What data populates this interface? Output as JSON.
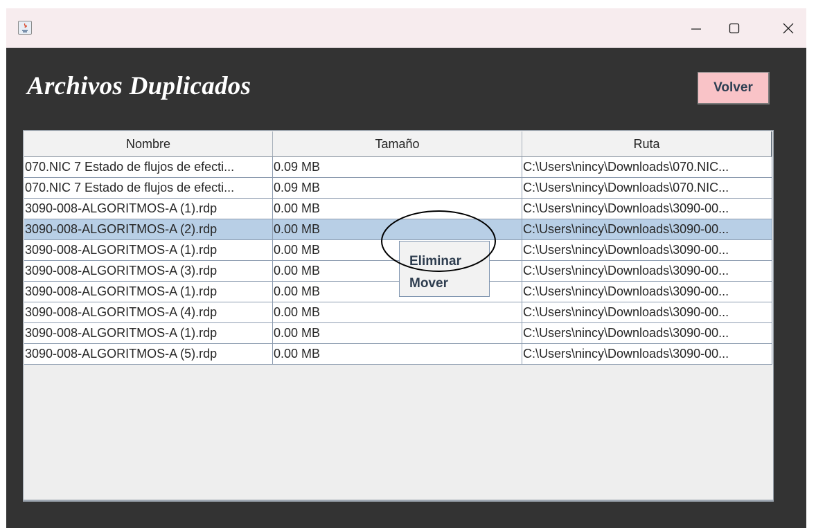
{
  "window": {
    "controls": {
      "minimize": "—",
      "maximize": "☐",
      "close": "✕"
    }
  },
  "header": {
    "title": "Archivos Duplicados",
    "back_button": "Volver"
  },
  "table": {
    "columns": [
      "Nombre",
      "Tamaño",
      "Ruta"
    ],
    "rows": [
      {
        "nombre": "070.NIC 7 Estado de flujos de efecti...",
        "tamano": "0.09 MB",
        "ruta": "C:\\Users\\nincy\\Downloads\\070.NIC..."
      },
      {
        "nombre": "070.NIC 7 Estado de flujos de efecti...",
        "tamano": "0.09 MB",
        "ruta": "C:\\Users\\nincy\\Downloads\\070.NIC..."
      },
      {
        "nombre": "3090-008-ALGORITMOS-A (1).rdp",
        "tamano": "0.00 MB",
        "ruta": "C:\\Users\\nincy\\Downloads\\3090-00..."
      },
      {
        "nombre": "3090-008-ALGORITMOS-A (2).rdp",
        "tamano": "0.00 MB",
        "ruta": "C:\\Users\\nincy\\Downloads\\3090-00...",
        "selected": true
      },
      {
        "nombre": "3090-008-ALGORITMOS-A (1).rdp",
        "tamano": "0.00 MB",
        "ruta": "C:\\Users\\nincy\\Downloads\\3090-00..."
      },
      {
        "nombre": "3090-008-ALGORITMOS-A (3).rdp",
        "tamano": "0.00 MB",
        "ruta": "C:\\Users\\nincy\\Downloads\\3090-00..."
      },
      {
        "nombre": "3090-008-ALGORITMOS-A (1).rdp",
        "tamano": "0.00 MB",
        "ruta": "C:\\Users\\nincy\\Downloads\\3090-00..."
      },
      {
        "nombre": "3090-008-ALGORITMOS-A (4).rdp",
        "tamano": "0.00 MB",
        "ruta": "C:\\Users\\nincy\\Downloads\\3090-00..."
      },
      {
        "nombre": "3090-008-ALGORITMOS-A (1).rdp",
        "tamano": "0.00 MB",
        "ruta": "C:\\Users\\nincy\\Downloads\\3090-00..."
      },
      {
        "nombre": "3090-008-ALGORITMOS-A (5).rdp",
        "tamano": "0.00 MB",
        "ruta": "C:\\Users\\nincy\\Downloads\\3090-00..."
      }
    ]
  },
  "context_menu": {
    "items": [
      "Eliminar",
      "Mover"
    ]
  },
  "icons": {
    "app": "java-icon",
    "minimize": "minimize-icon",
    "maximize": "maximize-icon",
    "close": "close-icon"
  },
  "colors": {
    "window_bg": "#333333",
    "titlebar_bg": "#f7ecee",
    "volver_bg": "#f9c3c7",
    "selected_row": "#b8cfe6",
    "panel_bg": "#eeeeee"
  }
}
